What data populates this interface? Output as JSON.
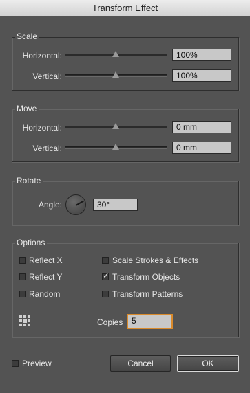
{
  "window": {
    "title": "Transform Effect"
  },
  "scale": {
    "legend": "Scale",
    "horizontal": {
      "label": "Horizontal:",
      "value": "100%",
      "slider_fraction": 0.5
    },
    "vertical": {
      "label": "Vertical:",
      "value": "100%",
      "slider_fraction": 0.5
    }
  },
  "move": {
    "legend": "Move",
    "horizontal": {
      "label": "Horizontal:",
      "value": "0 mm",
      "slider_fraction": 0.5
    },
    "vertical": {
      "label": "Vertical:",
      "value": "0 mm",
      "slider_fraction": 0.5
    }
  },
  "rotate": {
    "legend": "Rotate",
    "angle_label": "Angle:",
    "angle_value": "30°"
  },
  "options": {
    "legend": "Options",
    "reflect_x": {
      "label": "Reflect X",
      "checked": false
    },
    "reflect_y": {
      "label": "Reflect Y",
      "checked": false
    },
    "random": {
      "label": "Random",
      "checked": false
    },
    "scale_strokes": {
      "label": "Scale Strokes & Effects",
      "checked": false
    },
    "transform_objects": {
      "label": "Transform Objects",
      "checked": true
    },
    "transform_patterns": {
      "label": "Transform Patterns",
      "checked": false
    },
    "copies_label": "Copies",
    "copies_value": "5"
  },
  "footer": {
    "preview": {
      "label": "Preview",
      "checked": false
    },
    "cancel_label": "Cancel",
    "ok_label": "OK"
  },
  "colors": {
    "background": "#535353",
    "focus_ring": "#d98a2b"
  }
}
